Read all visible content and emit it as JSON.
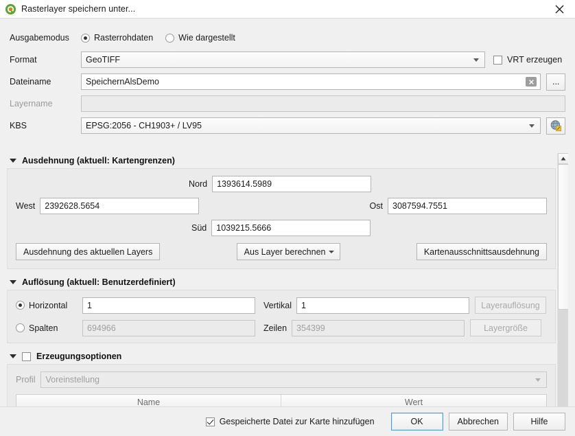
{
  "window": {
    "title": "Rasterlayer speichern unter...",
    "logo_icon": "qgis-logo-icon",
    "close_icon": "close-icon"
  },
  "output_mode": {
    "label": "Ausgabemodus",
    "options": [
      {
        "label": "Rasterrohdaten",
        "checked": true
      },
      {
        "label": "Wie dargestellt",
        "checked": false
      }
    ]
  },
  "format": {
    "label": "Format",
    "value": "GeoTIFF",
    "dropdown_icon": "chevron-down-icon"
  },
  "vrt": {
    "label": "VRT erzeugen",
    "checked": false
  },
  "filename": {
    "label": "Dateiname",
    "value": "SpeichernAlsDemo",
    "clear_icon": "clear-x-icon",
    "browse_label": "..."
  },
  "layername": {
    "label": "Layername",
    "value": "",
    "disabled": true
  },
  "crs": {
    "label": "KBS",
    "value": "EPSG:2056 - CH1903+ / LV95",
    "dropdown_icon": "chevron-down-icon",
    "select_icon": "crs-globe-icon"
  },
  "extent": {
    "title": "Ausdehnung (aktuell: Kartengrenzen)",
    "collapse_icon": "triangle-down-icon",
    "fields": {
      "north_label": "Nord",
      "north_value": "1393614.5989",
      "west_label": "West",
      "west_value": "2392628.5654",
      "east_label": "Ost",
      "east_value": "3087594.7551",
      "south_label": "Süd",
      "south_value": "1039215.5666"
    },
    "buttons": {
      "current_layer": "Ausdehnung des aktuellen Layers",
      "calc_from_layer": "Aus Layer berechnen",
      "calc_from_layer_icon": "chevron-down-icon",
      "map_canvas": "Kartenausschnittsausdehnung"
    }
  },
  "resolution": {
    "title": "Auflösung (aktuell: Benutzerdefiniert)",
    "collapse_icon": "triangle-down-icon",
    "horizontal": {
      "label": "Horizontal",
      "checked": true,
      "value": "1"
    },
    "vertical": {
      "label": "Vertikal",
      "value": "1"
    },
    "columns": {
      "label": "Spalten",
      "checked": false,
      "value": "694966",
      "disabled": true
    },
    "rows": {
      "label": "Zeilen",
      "value": "354399",
      "disabled": true
    },
    "layer_resolution_button": "Layerauflösung",
    "layer_size_button": "Layergröße"
  },
  "creation_options": {
    "title": "Erzeugungsoptionen",
    "collapse_icon": "triangle-down-icon",
    "checked": false,
    "profile_label": "Profil",
    "profile_value": "Voreinstellung",
    "profile_icon": "chevron-down-icon",
    "table": {
      "columns": [
        "Name",
        "Wert"
      ]
    }
  },
  "footer": {
    "add_to_map_label": "Gespeicherte Datei zur Karte hinzufügen",
    "add_to_map_checked": true,
    "ok_label": "OK",
    "cancel_label": "Abbrechen",
    "help_label": "Hilfe"
  },
  "scrollbar": {
    "up_icon": "scroll-up-icon",
    "down_icon": "scroll-down-icon"
  },
  "colors": {
    "accent": "#4e9ad4",
    "dialog_bg": "#f0f0f0",
    "panel_bg": "#ebebeb",
    "logo_green": "#589632"
  }
}
